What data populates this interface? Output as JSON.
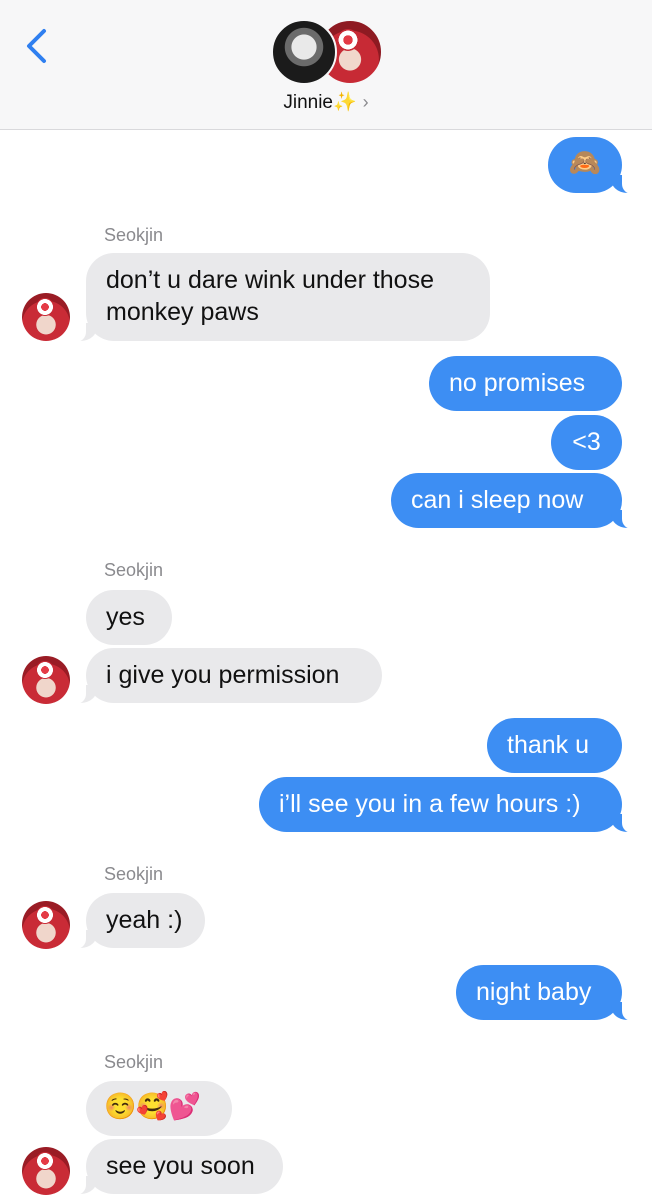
{
  "header": {
    "contact_name": "Jinnie✨",
    "chevron": "›",
    "back_icon": "back-chevron-icon"
  },
  "colors": {
    "outgoing_bubble": "#3d8ef3",
    "incoming_bubble": "#e9e9eb",
    "sender_label": "#8a8a8e",
    "back_button": "#2f7ff0"
  },
  "messages": {
    "m1": "🙈",
    "sender1": "Seokjin",
    "m2_line1": "don’t u dare wink under those",
    "m2_line2": "monkey paws",
    "m3": "no promises",
    "m4": "<3",
    "m5": "can i sleep now",
    "sender2": "Seokjin",
    "m6": "yes",
    "m7": "i give you permission",
    "m8": "thank u",
    "m9": "i’ll see you in a few hours :)",
    "sender3": "Seokjin",
    "m10": "yeah :)",
    "m11": "night baby",
    "sender4": "Seokjin",
    "m12": "☺️🥰💕",
    "m13": "see you soon"
  }
}
